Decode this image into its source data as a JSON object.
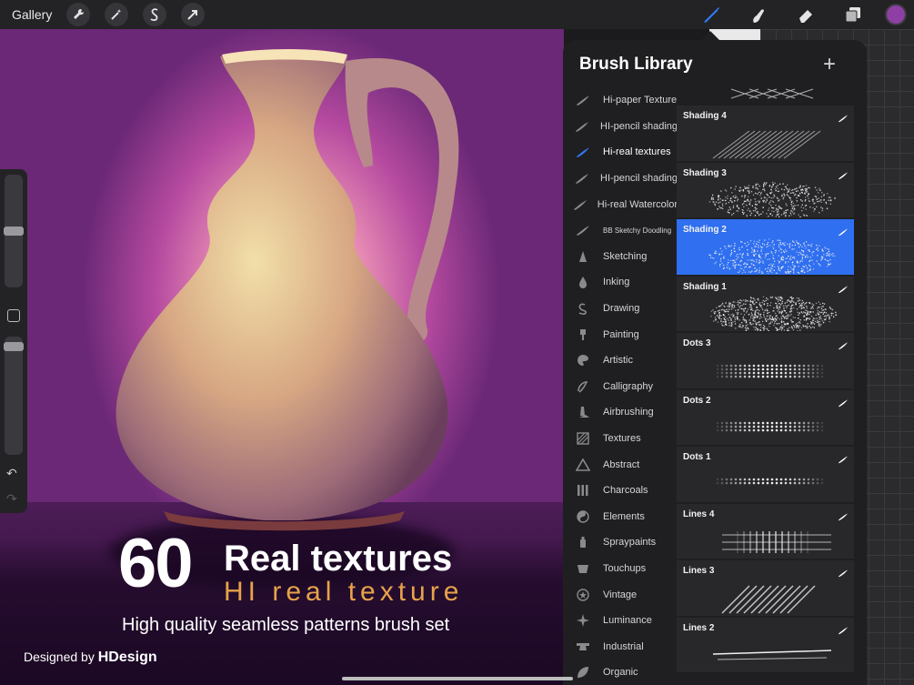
{
  "toolbar": {
    "gallery_label": "Gallery",
    "left_tools": [
      "wrench-icon",
      "magic-wand-icon",
      "selection-s-icon",
      "transform-arrow-icon"
    ],
    "right_tools": [
      "brush-icon",
      "smudge-icon",
      "eraser-icon",
      "layers-icon"
    ],
    "active_tool": "brush-icon",
    "current_color": "#8e3fa3",
    "accent_color": "#2f7cf6"
  },
  "artwork": {
    "headline_number": "60",
    "headline_text": "Real textures",
    "subtitle": "HI real texture",
    "tagline": "High quality seamless patterns brush set",
    "credit_prefix": "Designed by",
    "credit_name": "HDesign"
  },
  "brush_library": {
    "title": "Brush Library",
    "categories": [
      {
        "label": "Hi-paper Texture",
        "icon": "brush-stroke-icon"
      },
      {
        "label": "HI-pencil shading",
        "icon": "brush-stroke-icon"
      },
      {
        "label": "Hi-real textures",
        "icon": "brush-stroke-icon",
        "active": true
      },
      {
        "label": "HI-pencil shading",
        "icon": "brush-stroke-icon"
      },
      {
        "label": "Hi-real Watercolor",
        "icon": "brush-stroke-icon"
      },
      {
        "label": "BB Sketchy Doodling",
        "icon": "brush-stroke-icon"
      },
      {
        "label": "Sketching",
        "icon": "pencil-tip-icon"
      },
      {
        "label": "Inking",
        "icon": "ink-drop-icon"
      },
      {
        "label": "Drawing",
        "icon": "spiral-icon"
      },
      {
        "label": "Painting",
        "icon": "paint-brush-icon"
      },
      {
        "label": "Artistic",
        "icon": "palette-icon"
      },
      {
        "label": "Calligraphy",
        "icon": "calligraphy-icon"
      },
      {
        "label": "Airbrushing",
        "icon": "airbrush-icon"
      },
      {
        "label": "Textures",
        "icon": "texture-icon"
      },
      {
        "label": "Abstract",
        "icon": "triangle-icon"
      },
      {
        "label": "Charcoals",
        "icon": "charcoal-icon"
      },
      {
        "label": "Elements",
        "icon": "yin-yang-icon"
      },
      {
        "label": "Spraypaints",
        "icon": "spray-can-icon"
      },
      {
        "label": "Touchups",
        "icon": "bucket-icon"
      },
      {
        "label": "Vintage",
        "icon": "star-badge-icon"
      },
      {
        "label": "Luminance",
        "icon": "sparkle-icon"
      },
      {
        "label": "Industrial",
        "icon": "anvil-icon"
      },
      {
        "label": "Organic",
        "icon": "leaf-icon"
      }
    ],
    "brushes": [
      {
        "name": "Shading 4"
      },
      {
        "name": "Shading 3"
      },
      {
        "name": "Shading 2",
        "selected": true
      },
      {
        "name": "Shading 1"
      },
      {
        "name": "Dots 3"
      },
      {
        "name": "Dots 2"
      },
      {
        "name": "Dots 1"
      },
      {
        "name": "Lines 4"
      },
      {
        "name": "Lines 3"
      },
      {
        "name": "Lines 2"
      }
    ]
  },
  "sidebar": {
    "brush_size_level": 0.5,
    "opacity_level": 0.95,
    "undo_icon": "undo-icon",
    "redo_icon": "redo-icon",
    "modify_icon": "square-icon"
  }
}
